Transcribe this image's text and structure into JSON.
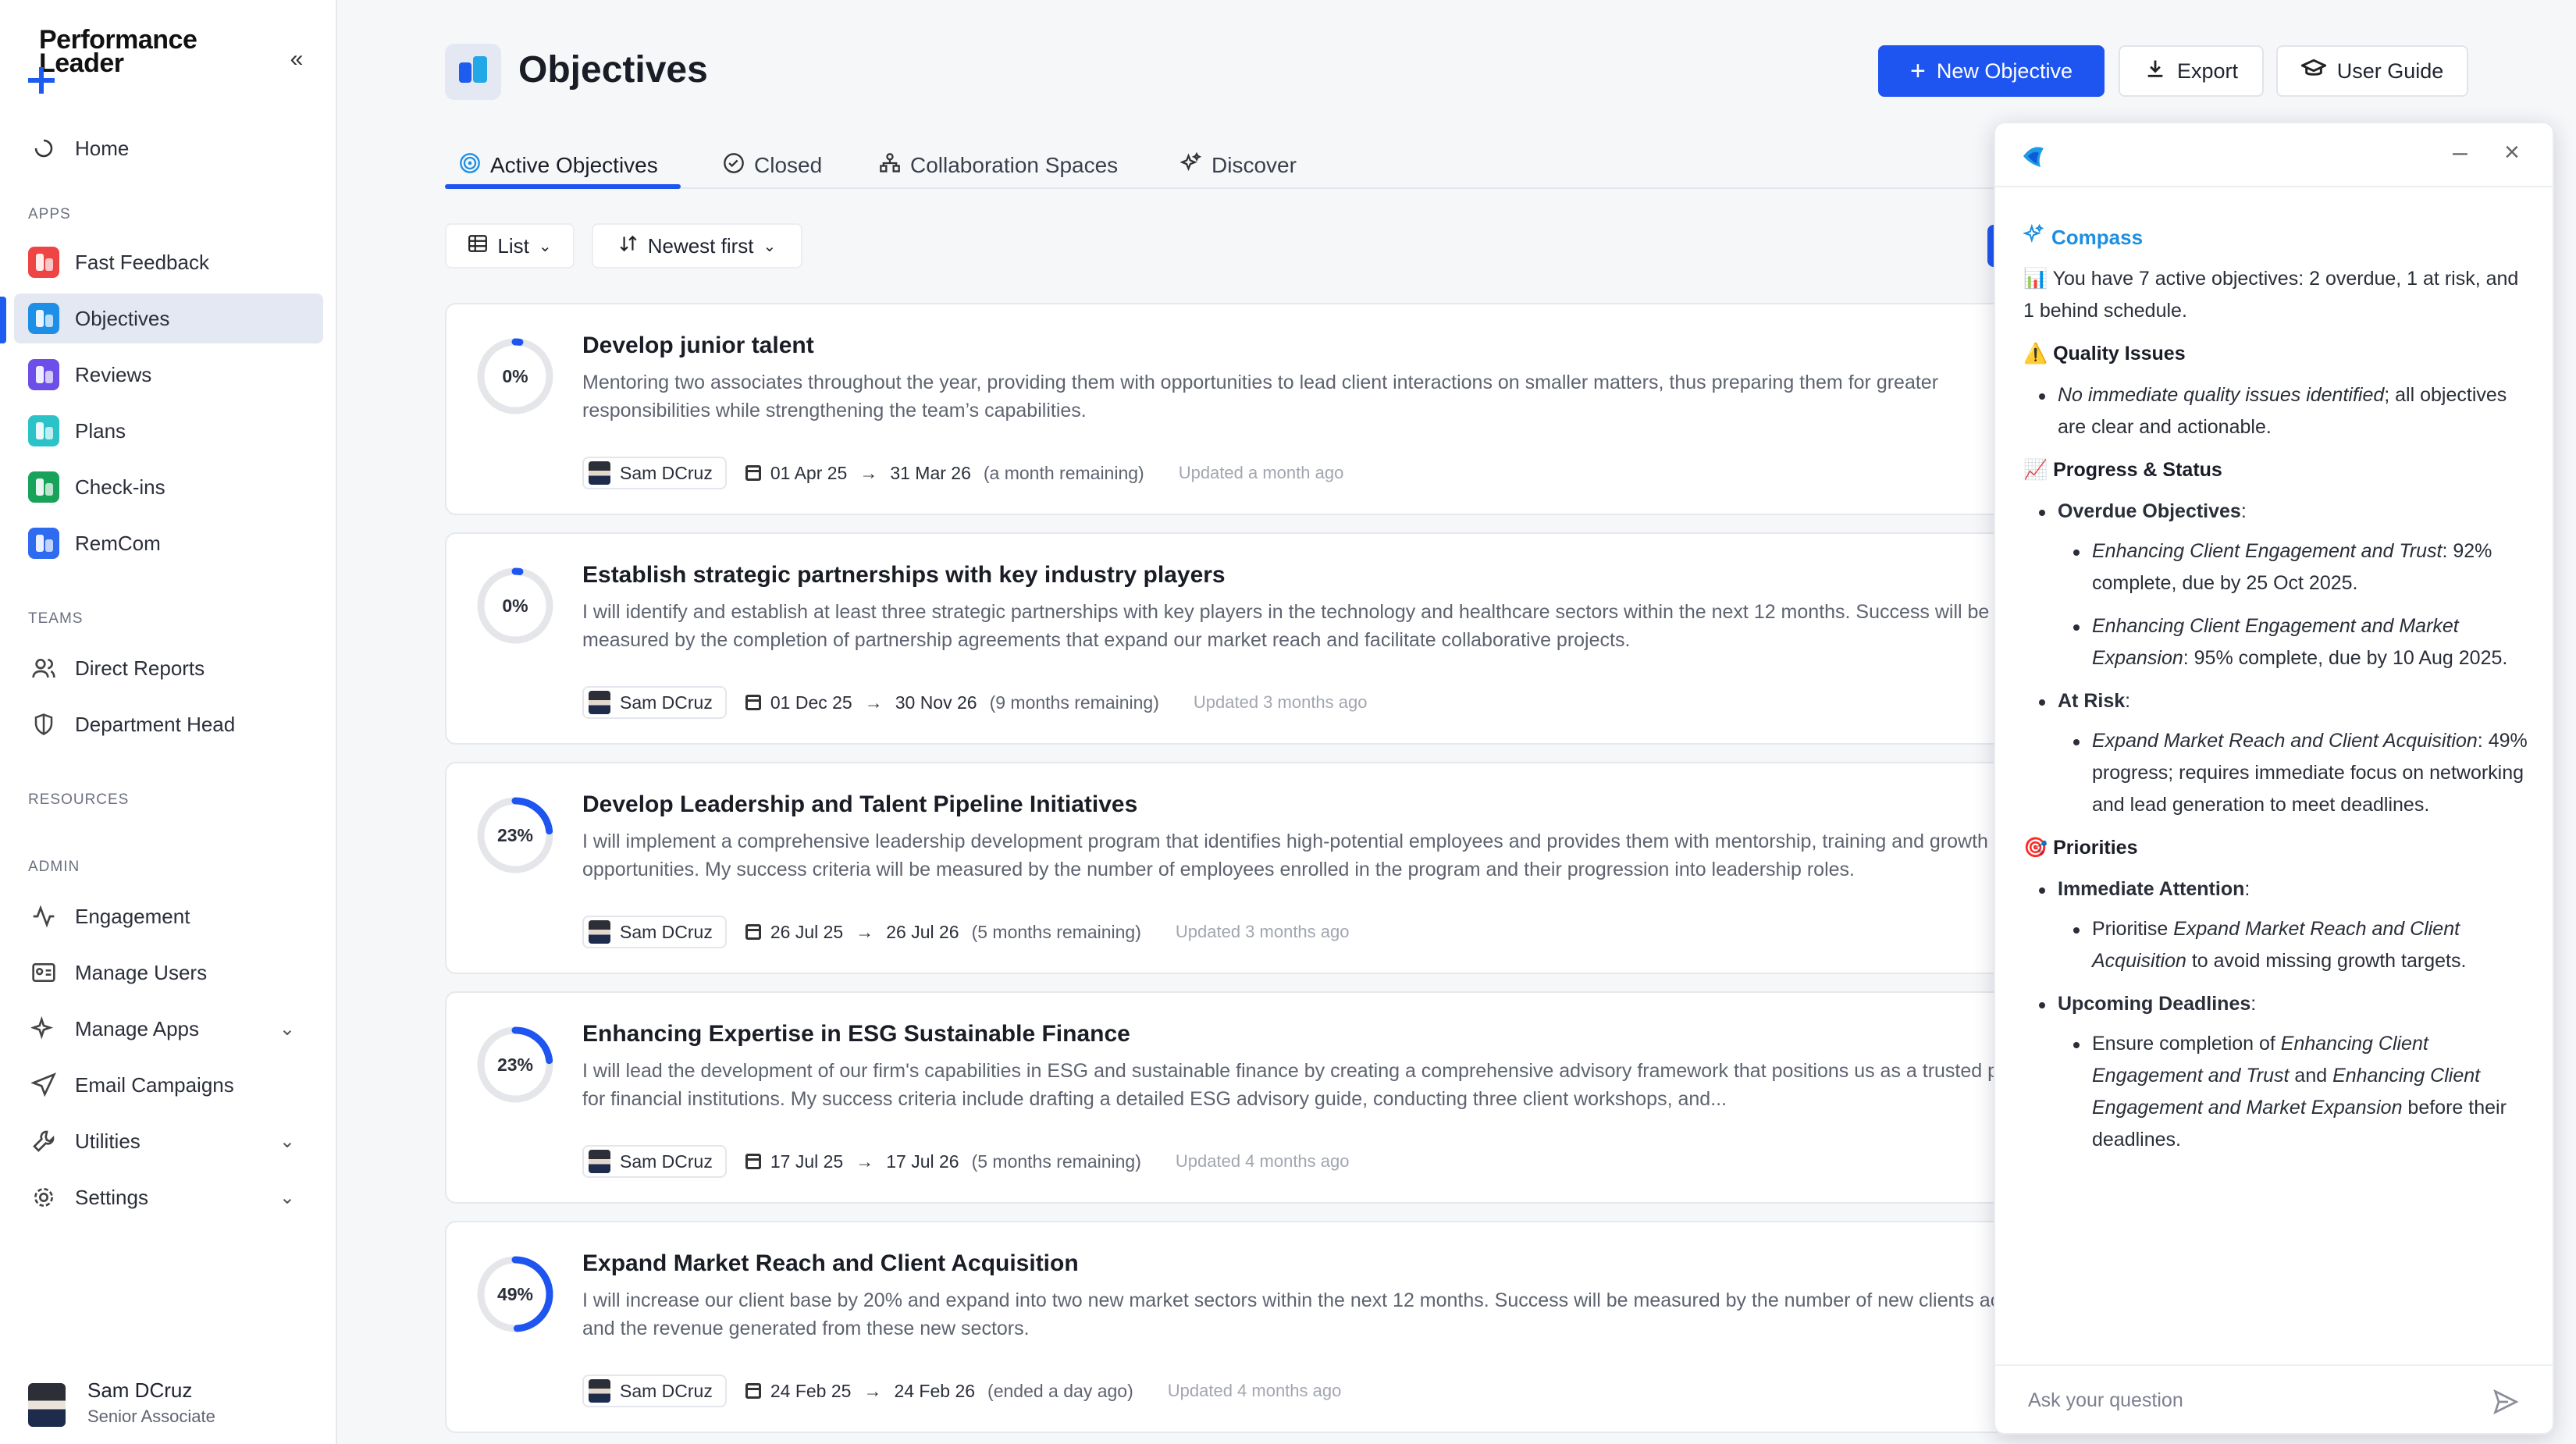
{
  "app": {
    "logo_text": "Performance\nLeader",
    "collapse_icon": "«"
  },
  "sidebar": {
    "home": "Home",
    "apps_label": "APPS",
    "apps": [
      {
        "label": "Fast Feedback",
        "color": "#ef4444"
      },
      {
        "label": "Objectives",
        "color": "#1e8fe6"
      },
      {
        "label": "Reviews",
        "color": "#6d4ee8"
      },
      {
        "label": "Plans",
        "color": "#2cc3c8"
      },
      {
        "label": "Check-ins",
        "color": "#19a35a"
      },
      {
        "label": "RemCom",
        "color": "#2f6bf0"
      }
    ],
    "teams_label": "TEAMS",
    "teams": [
      "Direct Reports",
      "Department Head"
    ],
    "resources_label": "RESOURCES",
    "admin_label": "ADMIN",
    "admin": [
      "Engagement",
      "Manage Users",
      "Manage Apps",
      "Email Campaigns",
      "Utilities",
      "Settings"
    ],
    "user": {
      "name": "Sam DCruz",
      "role": "Senior Associate"
    }
  },
  "header": {
    "title": "Objectives",
    "new_objective": "New Objective",
    "export": "Export",
    "user_guide": "User Guide"
  },
  "tabs": [
    "Active Objectives",
    "Closed",
    "Collaboration Spaces",
    "Discover"
  ],
  "filters": {
    "view": "List",
    "sort": "Newest first"
  },
  "objectives": [
    {
      "progress": 0,
      "progress_label": "0%",
      "title": "Develop junior talent",
      "description": "Mentoring two associates throughout the year, providing them with opportunities to lead client interactions on smaller matters, thus preparing them for greater responsibilities while strengthening the team’s capabilities.",
      "owner": "Sam DCruz",
      "start": "01 Apr 25",
      "end": "31 Mar 26",
      "remaining": "(a month remaining)",
      "updated": "Updated a month ago"
    },
    {
      "progress": 0,
      "progress_label": "0%",
      "title": "Establish strategic partnerships with key industry players",
      "description": "I will identify and establish at least three strategic partnerships with key players in the technology and healthcare sectors within the next 12 months. Success will be measured by the completion of partnership agreements that expand our market reach and facilitate collaborative projects.",
      "owner": "Sam DCruz",
      "start": "01 Dec 25",
      "end": "30 Nov 26",
      "remaining": "(9 months remaining)",
      "updated": "Updated 3 months ago"
    },
    {
      "progress": 23,
      "progress_label": "23%",
      "title": "Develop Leadership and Talent Pipeline Initiatives",
      "description": "I will implement a comprehensive leadership development program that identifies high-potential employees and provides them with mentorship, training and growth opportunities. My success criteria will be measured by the number of employees enrolled in the program and their progression into leadership roles.",
      "owner": "Sam DCruz",
      "start": "26 Jul 25",
      "end": "26 Jul 26",
      "remaining": "(5 months remaining)",
      "updated": "Updated 3 months ago"
    },
    {
      "progress": 23,
      "progress_label": "23%",
      "title": "Enhancing Expertise in ESG Sustainable Finance",
      "description": "I will lead the development of our firm's capabilities in ESG and sustainable finance by creating a comprehensive advisory framework that positions us as a trusted partner for financial institutions. My success criteria include drafting a detailed ESG advisory guide, conducting three client workshops, and...",
      "owner": "Sam DCruz",
      "start": "17 Jul 25",
      "end": "17 Jul 26",
      "remaining": "(5 months remaining)",
      "updated": "Updated 4 months ago"
    },
    {
      "progress": 49,
      "progress_label": "49%",
      "title": "Expand Market Reach and Client Acquisition",
      "description": "I will increase our client base by 20% and expand into two new market sectors within the next 12 months. Success will be measured by the number of new clients acquired and the revenue generated from these new sectors.",
      "owner": "Sam DCruz",
      "start": "24 Feb 25",
      "end": "24 Feb 26",
      "remaining": "(ended a day ago)",
      "updated": "Updated 4 months ago"
    }
  ],
  "chat": {
    "title": "Compass",
    "summary_emoji": "📊",
    "summary": "You have 7 active objectives: 2 overdue, 1 at risk, and 1 behind schedule.",
    "quality_heading": "Quality Issues",
    "quality_italic": "No immediate quality issues identified",
    "quality_rest": "; all objectives are clear and actionable.",
    "progress_heading": "Progress & Status",
    "overdue_heading": "Overdue Objectives",
    "overdue_1_italic": "Enhancing Client Engagement and Trust",
    "overdue_1_rest": ": 92% complete, due by 25 Oct 2025.",
    "overdue_2_italic": "Enhancing Client Engagement and Market Expansion",
    "overdue_2_rest": ": 95% complete, due by 10 Aug 2025.",
    "atrisk_heading": "At Risk",
    "atrisk_italic": "Expand Market Reach and Client Acquisition",
    "atrisk_rest": ": 49% progress; requires immediate focus on networking and lead generation to meet deadlines.",
    "priorities_heading": "Priorities",
    "immediate_heading": "Immediate Attention",
    "immediate_pre": "Prioritise ",
    "immediate_italic": "Expand Market Reach and Client Acquisition",
    "immediate_rest": " to avoid missing growth targets.",
    "upcoming_heading": "Upcoming Deadlines",
    "upcoming_pre": "Ensure completion of ",
    "upcoming_italic_1": "Enhancing Client Engagement and Trust",
    "upcoming_mid": " and ",
    "upcoming_italic_2": "Enhancing Client Engagement and Market Expansion",
    "upcoming_rest": " before their deadlines.",
    "input_placeholder": "Ask your question"
  },
  "colors": {
    "accent": "#1e55f0",
    "ring_track": "#e4e6ea"
  }
}
